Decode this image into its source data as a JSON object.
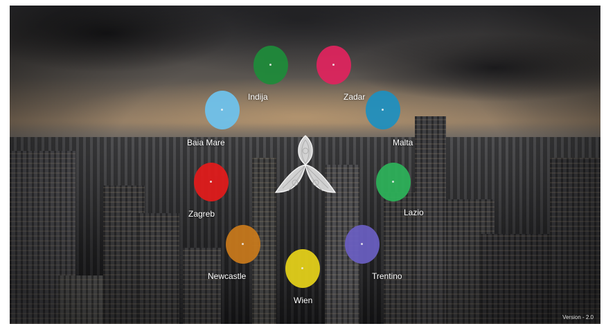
{
  "nodes": [
    {
      "label": "Indija",
      "color": "#1e8c3a"
    },
    {
      "label": "Zadar",
      "color": "#e0245e"
    },
    {
      "label": "Malta",
      "color": "#1e90c0"
    },
    {
      "label": "Lazio",
      "color": "#2db35a"
    },
    {
      "label": "Trentino",
      "color": "#6a5fc2"
    },
    {
      "label": "Wien",
      "color": "#e6d21a"
    },
    {
      "label": "Newcastle",
      "color": "#c97a1c"
    },
    {
      "label": "Zagreb",
      "color": "#e31b1b"
    },
    {
      "label": "Baia Mare",
      "color": "#6ec3ee"
    }
  ],
  "center_logo": {
    "icon": "trefoil-logo-icon"
  },
  "version": "Version - 2.0"
}
